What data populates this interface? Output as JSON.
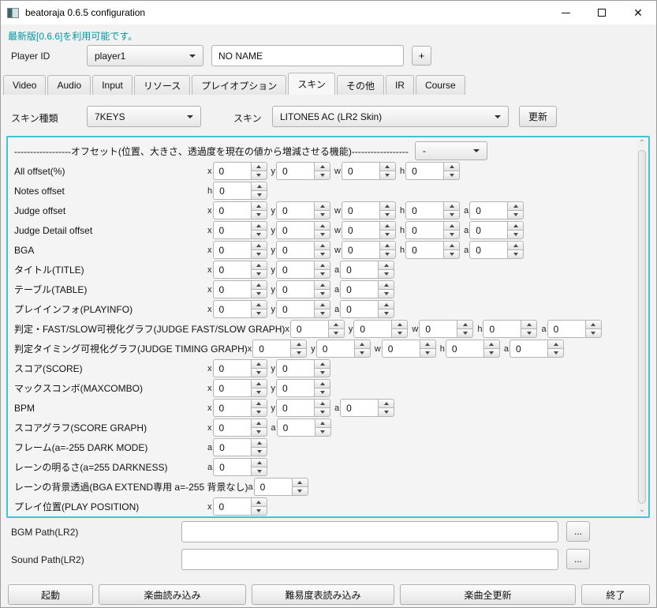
{
  "window": {
    "title": "beatoraja 0.6.5 configuration"
  },
  "notice": {
    "update_link": "最新版[0.6.6]を利用可能です。"
  },
  "player": {
    "label": "Player ID",
    "id_value": "player1",
    "name_value": "NO NAME",
    "add_button_label": "+"
  },
  "tabs": {
    "selected_index": 5,
    "items": [
      {
        "id": "video",
        "label": "Video"
      },
      {
        "id": "audio",
        "label": "Audio"
      },
      {
        "id": "input",
        "label": "Input"
      },
      {
        "id": "resource",
        "label": "リソース"
      },
      {
        "id": "play-option",
        "label": "プレイオプション"
      },
      {
        "id": "skin",
        "label": "スキン"
      },
      {
        "id": "other",
        "label": "その他"
      },
      {
        "id": "ir",
        "label": "IR"
      },
      {
        "id": "course",
        "label": "Course"
      }
    ]
  },
  "skin": {
    "type_label": "スキン種類",
    "type_value": "7KEYS",
    "skin_label": "スキン",
    "skin_value": "LITONE5 AC (LR2 Skin)",
    "update_button_label": "更新"
  },
  "offset_panel": {
    "header_label": "------------------オフセット(位置、大きさ、透過度を現在の値から増減させる機能)------------------",
    "header_dropdown_value": "-",
    "rows": [
      {
        "label": "All offset(%)",
        "fields": [
          {
            "k": "x",
            "v": "0"
          },
          {
            "k": "y",
            "v": "0"
          },
          {
            "k": "w",
            "v": "0"
          },
          {
            "k": "h",
            "v": "0"
          }
        ]
      },
      {
        "label": "Notes offset",
        "fields": [
          {
            "k": "h",
            "v": "0"
          }
        ]
      },
      {
        "label": "Judge offset",
        "fields": [
          {
            "k": "x",
            "v": "0"
          },
          {
            "k": "y",
            "v": "0"
          },
          {
            "k": "w",
            "v": "0"
          },
          {
            "k": "h",
            "v": "0"
          },
          {
            "k": "a",
            "v": "0"
          }
        ]
      },
      {
        "label": "Judge Detail offset",
        "fields": [
          {
            "k": "x",
            "v": "0"
          },
          {
            "k": "y",
            "v": "0"
          },
          {
            "k": "w",
            "v": "0"
          },
          {
            "k": "h",
            "v": "0"
          },
          {
            "k": "a",
            "v": "0"
          }
        ]
      },
      {
        "label": "BGA",
        "fields": [
          {
            "k": "x",
            "v": "0"
          },
          {
            "k": "y",
            "v": "0"
          },
          {
            "k": "w",
            "v": "0"
          },
          {
            "k": "h",
            "v": "0"
          },
          {
            "k": "a",
            "v": "0"
          }
        ]
      },
      {
        "label": "タイトル(TITLE)",
        "fields": [
          {
            "k": "x",
            "v": "0"
          },
          {
            "k": "y",
            "v": "0"
          },
          {
            "k": "a",
            "v": "0"
          }
        ]
      },
      {
        "label": "テーブル(TABLE)",
        "fields": [
          {
            "k": "x",
            "v": "0"
          },
          {
            "k": "y",
            "v": "0"
          },
          {
            "k": "a",
            "v": "0"
          }
        ]
      },
      {
        "label": "プレイインフォ(PLAYINFO)",
        "fields": [
          {
            "k": "x",
            "v": "0"
          },
          {
            "k": "y",
            "v": "0"
          },
          {
            "k": "a",
            "v": "0"
          }
        ]
      },
      {
        "label": "判定・FAST/SLOW可視化グラフ(JUDGE FAST/SLOW GRAPH)",
        "fields": [
          {
            "k": "x",
            "v": "0"
          },
          {
            "k": "y",
            "v": "0"
          },
          {
            "k": "w",
            "v": "0"
          },
          {
            "k": "h",
            "v": "0"
          },
          {
            "k": "a",
            "v": "0"
          }
        ]
      },
      {
        "label": "判定タイミング可視化グラフ(JUDGE TIMING GRAPH)",
        "fields": [
          {
            "k": "x",
            "v": "0"
          },
          {
            "k": "y",
            "v": "0"
          },
          {
            "k": "w",
            "v": "0"
          },
          {
            "k": "h",
            "v": "0"
          },
          {
            "k": "a",
            "v": "0"
          }
        ]
      },
      {
        "label": "スコア(SCORE)",
        "fields": [
          {
            "k": "x",
            "v": "0"
          },
          {
            "k": "y",
            "v": "0"
          }
        ]
      },
      {
        "label": "マックスコンボ(MAXCOMBO)",
        "fields": [
          {
            "k": "x",
            "v": "0"
          },
          {
            "k": "y",
            "v": "0"
          }
        ]
      },
      {
        "label": "BPM",
        "fields": [
          {
            "k": "x",
            "v": "0"
          },
          {
            "k": "y",
            "v": "0"
          },
          {
            "k": "a",
            "v": "0"
          }
        ]
      },
      {
        "label": "スコアグラフ(SCORE GRAPH)",
        "fields": [
          {
            "k": "x",
            "v": "0"
          },
          {
            "k": "a",
            "v": "0"
          }
        ]
      },
      {
        "label": "フレーム(a=-255 DARK MODE)",
        "fields": [
          {
            "k": "a",
            "v": "0"
          }
        ]
      },
      {
        "label": "レーンの明るさ(a=255 DARKNESS)",
        "fields": [
          {
            "k": "a",
            "v": "0"
          }
        ]
      },
      {
        "label": "レーンの背景透過(BGA EXTEND専用 a=-255 背景なし)",
        "fields": [
          {
            "k": "a",
            "v": "0"
          }
        ]
      },
      {
        "label": "プレイ位置(PLAY POSITION)",
        "fields": [
          {
            "k": "x",
            "v": "0"
          }
        ]
      }
    ]
  },
  "paths": [
    {
      "label": "BGM Path(LR2)",
      "value": "",
      "browse_label": "..."
    },
    {
      "label": "Sound Path(LR2)",
      "value": "",
      "browse_label": "..."
    }
  ],
  "bottom_buttons": [
    {
      "id": "launch",
      "label": "起動"
    },
    {
      "id": "load-songs",
      "label": "楽曲読み込み"
    },
    {
      "id": "load-difficulty-tables",
      "label": "難易度表読み込み"
    },
    {
      "id": "update-all-songs",
      "label": "楽曲全更新"
    },
    {
      "id": "exit",
      "label": "終了"
    }
  ],
  "colors": {
    "accent_border": "#43c2d4",
    "link": "#0097a7"
  }
}
